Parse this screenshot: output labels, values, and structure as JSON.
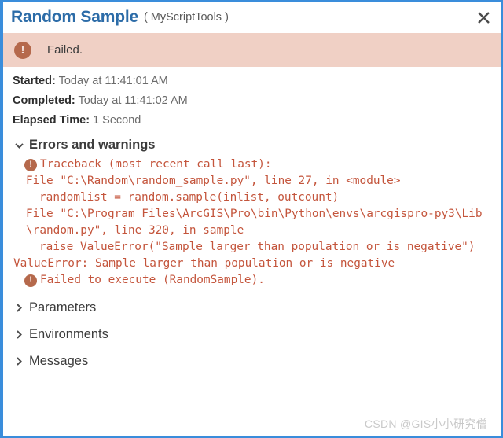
{
  "window": {
    "border_color": "#3a8ddb",
    "title": "Random Sample",
    "toolbox": "( MyScriptTools )",
    "close_icon": "close-icon"
  },
  "banner": {
    "icon": "error-icon",
    "icon_glyph": "!",
    "text": "Failed.",
    "bg_color": "#f0d0c5",
    "icon_color": "#b5694c"
  },
  "meta": {
    "started_label": "Started:",
    "started_value": "Today at 11:41:01 AM",
    "completed_label": "Completed:",
    "completed_value": "Today at 11:41:02 AM",
    "elapsed_label": "Elapsed Time:",
    "elapsed_value": "1 Second"
  },
  "errors_section": {
    "chevron": "chevron-down-icon",
    "title": "Errors and warnings",
    "expanded": true,
    "text_color": "#c4553c",
    "lines": [
      {
        "text": "Traceback (most recent call last):",
        "indent": 0,
        "icon": true
      },
      {
        "text": "File \"C:\\Random\\random_sample.py\", line 27, in <module>",
        "indent": 1,
        "icon": false
      },
      {
        "text": "randomlist = random.sample(inlist, outcount)",
        "indent": 2,
        "icon": false
      },
      {
        "text": "File \"C:\\Program Files\\ArcGIS\\Pro\\bin\\Python\\envs\\arcgispro-py3\\Lib\\random.py\", line 320, in sample",
        "indent": 1,
        "icon": false
      },
      {
        "text": "raise ValueError(\"Sample larger than population or is negative\")",
        "indent": 2,
        "icon": false
      },
      {
        "text": "ValueError: Sample larger than population or is negative",
        "indent": 0,
        "icon": false
      },
      {
        "text": "Failed to execute (RandomSample).",
        "indent": 0,
        "icon": true
      }
    ]
  },
  "collapsed_sections": [
    {
      "chevron": "chevron-right-icon",
      "title": "Parameters",
      "expanded": false
    },
    {
      "chevron": "chevron-right-icon",
      "title": "Environments",
      "expanded": false
    },
    {
      "chevron": "chevron-right-icon",
      "title": "Messages",
      "expanded": false
    }
  ],
  "watermark": {
    "text": "CSDN @GIS小小研究僧"
  }
}
